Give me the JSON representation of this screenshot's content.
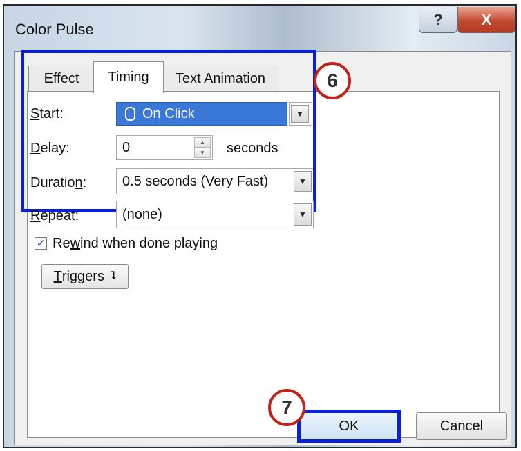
{
  "window": {
    "title": "Color Pulse",
    "help_glyph": "?",
    "close_glyph": "X"
  },
  "tabs": [
    {
      "label": "Effect",
      "active": false
    },
    {
      "label": "Timing",
      "active": true
    },
    {
      "label": "Text Animation",
      "active": false
    }
  ],
  "timing": {
    "start_label_mn": "S",
    "start_label_rest": "tart:",
    "start_value": "On Click",
    "delay_label_mn": "D",
    "delay_label_rest": "elay:",
    "delay_value": "0",
    "delay_unit": "seconds",
    "duration_label_a": "Duratio",
    "duration_label_mn": "n",
    "duration_label_b": ":",
    "duration_value": "0.5 seconds (Very Fast)",
    "repeat_label_mn": "R",
    "repeat_label_rest": "epeat:",
    "repeat_value": "(none)",
    "rewind_label_a": "Re",
    "rewind_label_mn": "w",
    "rewind_label_b": "ind when done playing",
    "rewind_checked": true,
    "triggers_label_mn": "T",
    "triggers_label_rest": "riggers",
    "triggers_glyph": "⮧"
  },
  "callouts": {
    "step_6": "6",
    "step_7": "7"
  },
  "buttons": {
    "ok": "OK",
    "cancel": "Cancel"
  },
  "colors": {
    "highlight": "#0a1fd6",
    "callout_ring": "#c02218",
    "selection": "#3a78d8"
  }
}
